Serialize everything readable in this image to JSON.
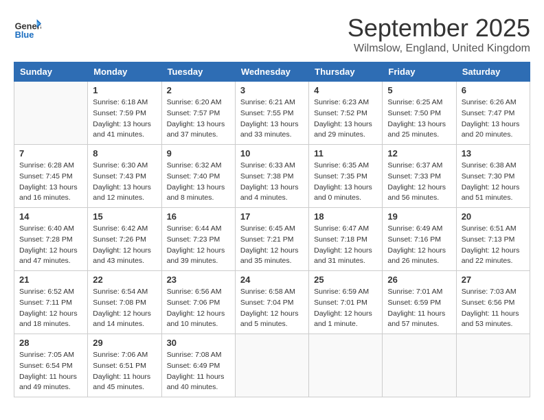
{
  "logo": {
    "general": "General",
    "blue": "Blue"
  },
  "title": "September 2025",
  "subtitle": "Wilmslow, England, United Kingdom",
  "days_of_week": [
    "Sunday",
    "Monday",
    "Tuesday",
    "Wednesday",
    "Thursday",
    "Friday",
    "Saturday"
  ],
  "weeks": [
    [
      {
        "day": "",
        "info": ""
      },
      {
        "day": "1",
        "info": "Sunrise: 6:18 AM\nSunset: 7:59 PM\nDaylight: 13 hours\nand 41 minutes."
      },
      {
        "day": "2",
        "info": "Sunrise: 6:20 AM\nSunset: 7:57 PM\nDaylight: 13 hours\nand 37 minutes."
      },
      {
        "day": "3",
        "info": "Sunrise: 6:21 AM\nSunset: 7:55 PM\nDaylight: 13 hours\nand 33 minutes."
      },
      {
        "day": "4",
        "info": "Sunrise: 6:23 AM\nSunset: 7:52 PM\nDaylight: 13 hours\nand 29 minutes."
      },
      {
        "day": "5",
        "info": "Sunrise: 6:25 AM\nSunset: 7:50 PM\nDaylight: 13 hours\nand 25 minutes."
      },
      {
        "day": "6",
        "info": "Sunrise: 6:26 AM\nSunset: 7:47 PM\nDaylight: 13 hours\nand 20 minutes."
      }
    ],
    [
      {
        "day": "7",
        "info": "Sunrise: 6:28 AM\nSunset: 7:45 PM\nDaylight: 13 hours\nand 16 minutes."
      },
      {
        "day": "8",
        "info": "Sunrise: 6:30 AM\nSunset: 7:43 PM\nDaylight: 13 hours\nand 12 minutes."
      },
      {
        "day": "9",
        "info": "Sunrise: 6:32 AM\nSunset: 7:40 PM\nDaylight: 13 hours\nand 8 minutes."
      },
      {
        "day": "10",
        "info": "Sunrise: 6:33 AM\nSunset: 7:38 PM\nDaylight: 13 hours\nand 4 minutes."
      },
      {
        "day": "11",
        "info": "Sunrise: 6:35 AM\nSunset: 7:35 PM\nDaylight: 13 hours\nand 0 minutes."
      },
      {
        "day": "12",
        "info": "Sunrise: 6:37 AM\nSunset: 7:33 PM\nDaylight: 12 hours\nand 56 minutes."
      },
      {
        "day": "13",
        "info": "Sunrise: 6:38 AM\nSunset: 7:30 PM\nDaylight: 12 hours\nand 51 minutes."
      }
    ],
    [
      {
        "day": "14",
        "info": "Sunrise: 6:40 AM\nSunset: 7:28 PM\nDaylight: 12 hours\nand 47 minutes."
      },
      {
        "day": "15",
        "info": "Sunrise: 6:42 AM\nSunset: 7:26 PM\nDaylight: 12 hours\nand 43 minutes."
      },
      {
        "day": "16",
        "info": "Sunrise: 6:44 AM\nSunset: 7:23 PM\nDaylight: 12 hours\nand 39 minutes."
      },
      {
        "day": "17",
        "info": "Sunrise: 6:45 AM\nSunset: 7:21 PM\nDaylight: 12 hours\nand 35 minutes."
      },
      {
        "day": "18",
        "info": "Sunrise: 6:47 AM\nSunset: 7:18 PM\nDaylight: 12 hours\nand 31 minutes."
      },
      {
        "day": "19",
        "info": "Sunrise: 6:49 AM\nSunset: 7:16 PM\nDaylight: 12 hours\nand 26 minutes."
      },
      {
        "day": "20",
        "info": "Sunrise: 6:51 AM\nSunset: 7:13 PM\nDaylight: 12 hours\nand 22 minutes."
      }
    ],
    [
      {
        "day": "21",
        "info": "Sunrise: 6:52 AM\nSunset: 7:11 PM\nDaylight: 12 hours\nand 18 minutes."
      },
      {
        "day": "22",
        "info": "Sunrise: 6:54 AM\nSunset: 7:08 PM\nDaylight: 12 hours\nand 14 minutes."
      },
      {
        "day": "23",
        "info": "Sunrise: 6:56 AM\nSunset: 7:06 PM\nDaylight: 12 hours\nand 10 minutes."
      },
      {
        "day": "24",
        "info": "Sunrise: 6:58 AM\nSunset: 7:04 PM\nDaylight: 12 hours\nand 5 minutes."
      },
      {
        "day": "25",
        "info": "Sunrise: 6:59 AM\nSunset: 7:01 PM\nDaylight: 12 hours\nand 1 minute."
      },
      {
        "day": "26",
        "info": "Sunrise: 7:01 AM\nSunset: 6:59 PM\nDaylight: 11 hours\nand 57 minutes."
      },
      {
        "day": "27",
        "info": "Sunrise: 7:03 AM\nSunset: 6:56 PM\nDaylight: 11 hours\nand 53 minutes."
      }
    ],
    [
      {
        "day": "28",
        "info": "Sunrise: 7:05 AM\nSunset: 6:54 PM\nDaylight: 11 hours\nand 49 minutes."
      },
      {
        "day": "29",
        "info": "Sunrise: 7:06 AM\nSunset: 6:51 PM\nDaylight: 11 hours\nand 45 minutes."
      },
      {
        "day": "30",
        "info": "Sunrise: 7:08 AM\nSunset: 6:49 PM\nDaylight: 11 hours\nand 40 minutes."
      },
      {
        "day": "",
        "info": ""
      },
      {
        "day": "",
        "info": ""
      },
      {
        "day": "",
        "info": ""
      },
      {
        "day": "",
        "info": ""
      }
    ]
  ]
}
